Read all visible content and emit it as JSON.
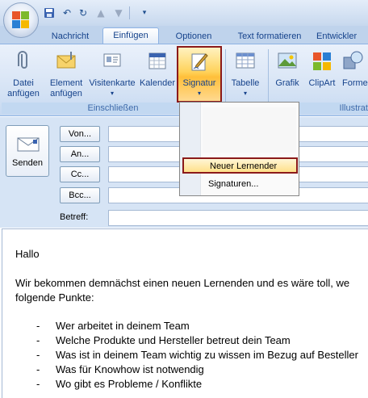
{
  "tabs": [
    "Nachricht",
    "Einfügen",
    "Optionen",
    "Text formatieren",
    "Entwickler"
  ],
  "active_tab": "Einfügen",
  "ribbon": {
    "buttons": [
      {
        "label1": "Datei",
        "label2": "anfügen"
      },
      {
        "label1": "Element",
        "label2": "anfügen"
      },
      {
        "label1": "Visitenkarte",
        "label2": ""
      },
      {
        "label1": "Kalender",
        "label2": ""
      },
      {
        "label1": "Signatur",
        "label2": ""
      },
      {
        "label1": "Tabelle",
        "label2": ""
      },
      {
        "label1": "Grafik",
        "label2": ""
      },
      {
        "label1": "ClipArt",
        "label2": ""
      },
      {
        "label1": "Formen",
        "label2": ""
      }
    ],
    "groups": [
      "Einschließen",
      "Illustrat"
    ]
  },
  "compose": {
    "send": "Senden",
    "von": "Von...",
    "an": "An...",
    "cc": "Cc...",
    "bcc": "Bcc...",
    "betreff": "Betreff:"
  },
  "menu": {
    "items": [
      "Neuer Lernender",
      "Signaturen..."
    ]
  },
  "body": {
    "greeting": "Hallo",
    "line1": "Wir bekommen demnächst einen neuen Lernenden und es wäre toll, we",
    "line2": "folgende Punkte:",
    "bullets": [
      "Wer arbeitet in deinem Team",
      "Welche Produkte und Hersteller betreut dein Team",
      "Was ist in deinem Team wichtig zu wissen im Bezug auf Besteller",
      "Was für Knowhow ist notwendig",
      "Wo gibt es Probleme / Konflikte"
    ],
    "bullet_char": "-"
  }
}
